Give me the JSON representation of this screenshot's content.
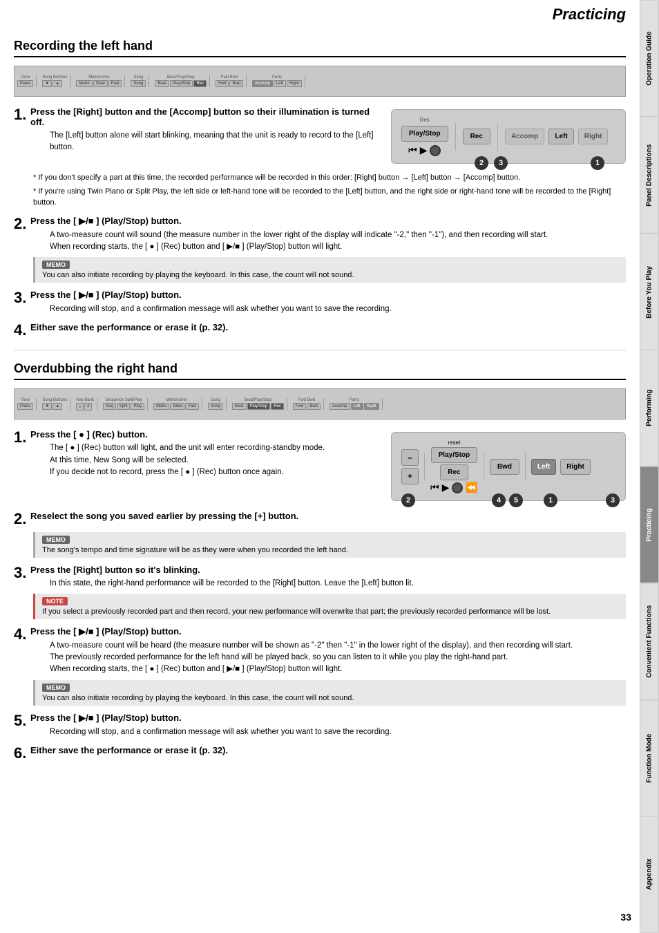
{
  "page": {
    "title": "Practicing",
    "number": "33"
  },
  "sidebar": {
    "tabs": [
      {
        "label": "Operation Guide",
        "active": false
      },
      {
        "label": "Panel Descriptions",
        "active": false
      },
      {
        "label": "Before You Play",
        "active": false
      },
      {
        "label": "Performing",
        "active": false
      },
      {
        "label": "Practicing",
        "active": true
      },
      {
        "label": "Convenient Functions",
        "active": false
      },
      {
        "label": "Function Mode",
        "active": false
      },
      {
        "label": "Appendix",
        "active": false
      }
    ]
  },
  "section1": {
    "heading": "Recording the left hand",
    "steps": [
      {
        "number": "1",
        "title": "Press the [Right] button and the [Accomp] button so their illumination is turned off.",
        "body": "The [Left] button alone will start blinking, meaning that the unit is ready to record to the [Left] button."
      },
      {
        "number": "2",
        "title": "Press the [ ▶/■ ] (Play/Stop) button.",
        "body": "A two-measure count will sound (the measure number in the lower right of the display will indicate \"-2,\" then \"-1\"), and then recording will start.\nWhen recording starts, the [ ● ] (Rec) button and [ ▶/■ ] (Play/Stop) button will light."
      },
      {
        "number": "3",
        "title": "Press the [ ▶/■ ] (Play/Stop) button.",
        "body": "Recording will stop, and a confirmation message will ask whether you want to save the recording."
      },
      {
        "number": "4",
        "title": "Either save the performance or erase it (p. 32).",
        "body": ""
      }
    ],
    "memo1": {
      "label": "MEMO",
      "text": "You can also initiate recording by playing the keyboard. In this case, the count will not sound."
    },
    "bullets": [
      "If you don't specify a part at this time, the recorded performance will be recorded in this order: [Right] button → [Left] button → [Accomp] button.",
      "If you're using Twin Piano or Split Play, the left side or left-hand tone will be recorded to the [Left] button, and the right side or right-hand tone will be recorded to the [Right] button."
    ]
  },
  "section2": {
    "heading": "Overdubbing the right hand",
    "steps": [
      {
        "number": "1",
        "title": "Press the [ ● ] (Rec) button.",
        "body": "The [ ● ] (Rec) button will light, and the unit will enter recording-standby mode.\nAt this time, New Song will be selected.\nIf you decide not to record, press the [ ● ] (Rec) button once again."
      },
      {
        "number": "2",
        "title": "Reselect the song you saved earlier by pressing the [+] button.",
        "body": ""
      },
      {
        "number": "3",
        "title": "Press the [Right] button so it's blinking.",
        "body": "In this state, the right-hand performance will be recorded to the [Right] button. Leave the [Left] button lit."
      },
      {
        "number": "4",
        "title": "Press the [ ▶/■ ] (Play/Stop) button.",
        "body": "A two-measure count will be heard (the measure number will be shown as \"-2\" then \"-1\" in the lower right of the display), and then recording will start.\nThe previously recorded performance for the left hand will be played back, so you can listen to it while you play the right-hand part.\nWhen recording starts, the [ ● ] (Rec) button and [ ▶/■ ] (Play/Stop) button will light."
      },
      {
        "number": "5",
        "title": "Press the [ ▶/■ ] (Play/Stop) button.",
        "body": "Recording will stop, and a confirmation message will ask whether you want to save the recording."
      },
      {
        "number": "6",
        "title": "Either save the performance or erase it (p. 32).",
        "body": ""
      }
    ],
    "memo2": {
      "label": "MEMO",
      "text": "The song's tempo and time signature will be as they were when you recorded the left hand."
    },
    "memo3": {
      "label": "MEMO",
      "text": "You can also initiate recording by playing the keyboard. In this case, the count will not sound."
    },
    "note1": {
      "label": "NOTE",
      "text": "If you select a previously recorded part and then record, your new performance will overwrite that part; the previously recorded performance will be lost."
    }
  },
  "buttons": {
    "playstop": "Play/Stop",
    "rec": "Rec",
    "accomp": "Accomp",
    "left": "Left",
    "right": "Right",
    "bwd": "Bwd",
    "minus": "–",
    "plus": "+"
  }
}
